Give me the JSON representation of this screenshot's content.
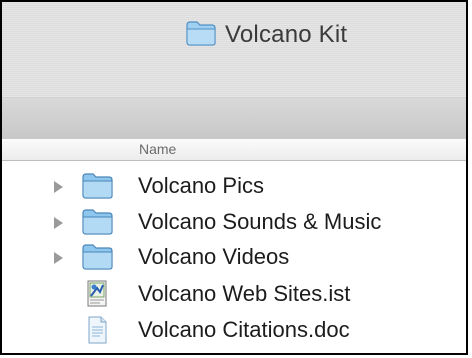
{
  "window": {
    "title": "Volcano Kit",
    "title_icon": "folder-icon"
  },
  "list": {
    "column_header": "Name",
    "items": [
      {
        "label": "Volcano Pics",
        "type": "folder",
        "icon": "folder-icon",
        "expandable": true
      },
      {
        "label": "Volcano Sounds & Music",
        "type": "folder",
        "icon": "folder-icon",
        "expandable": true
      },
      {
        "label": "Volcano Videos",
        "type": "folder",
        "icon": "folder-icon",
        "expandable": true
      },
      {
        "label": "Volcano Web Sites.ist",
        "type": "file",
        "icon": "inspiration-file-icon",
        "expandable": false
      },
      {
        "label": "Volcano Citations.doc",
        "type": "file",
        "icon": "document-file-icon",
        "expandable": false
      }
    ]
  },
  "colors": {
    "folder": "#8fc6ee",
    "disclosure": "#9a9a9a",
    "text": "#1c1c1c"
  }
}
